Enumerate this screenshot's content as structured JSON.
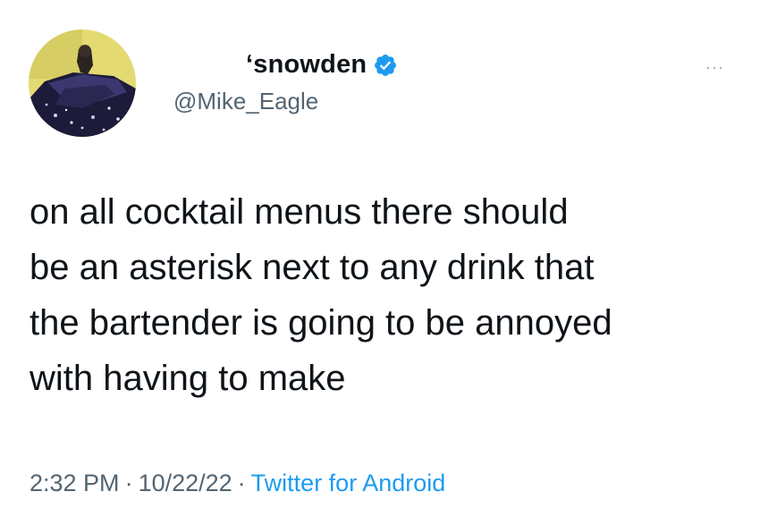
{
  "author": {
    "display_name": "ʻsnowden",
    "handle": "@Mike_Eagle",
    "verified": true,
    "avatar_icon": "avatar-icon",
    "verified_icon": "verified-badge-icon"
  },
  "more_menu": {
    "label": "···",
    "icon": "more-options-icon"
  },
  "tweet": {
    "lines": [
      "on all cocktail menus there should",
      "be an asterisk next to any drink that",
      "the bartender is going to be annoyed",
      "with having to make"
    ]
  },
  "meta": {
    "time": "2:32 PM",
    "date": "10/22/22",
    "separator": "·",
    "source": "Twitter for Android"
  },
  "colors": {
    "text": "#0f1419",
    "secondary": "#536471",
    "accent": "#1d9bf0",
    "background": "#ffffff"
  }
}
